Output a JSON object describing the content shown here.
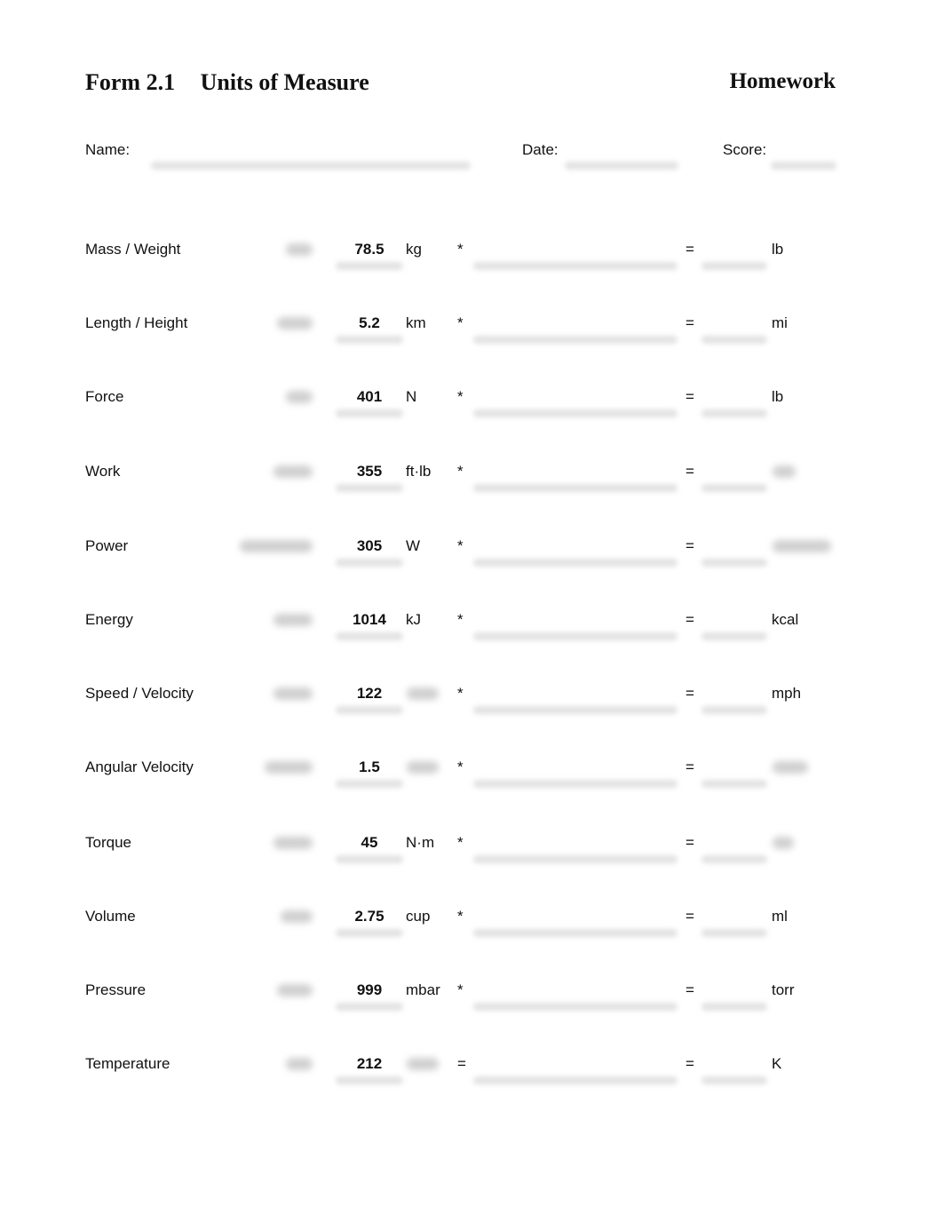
{
  "header": {
    "form_number": "Form 2.1",
    "title": "Units of Measure",
    "type": "Homework"
  },
  "fields": {
    "name_label": "Name:",
    "date_label": "Date:",
    "score_label": "Score:"
  },
  "rows": [
    {
      "label": "Mass / Weight",
      "value": "78.5",
      "from_unit": "kg",
      "operator": "*",
      "equals": "=",
      "to_unit": "lb"
    },
    {
      "label": "Length / Height",
      "value": "5.2",
      "from_unit": "km",
      "operator": "*",
      "equals": "=",
      "to_unit": "mi"
    },
    {
      "label": "Force",
      "value": "401",
      "from_unit": "N",
      "operator": "*",
      "equals": "=",
      "to_unit": "lb"
    },
    {
      "label": "Work",
      "value": "355",
      "from_unit": "ft·lb",
      "operator": "*",
      "equals": "=",
      "to_unit": ""
    },
    {
      "label": "Power",
      "value": "305",
      "from_unit": "W",
      "operator": "*",
      "equals": "=",
      "to_unit": ""
    },
    {
      "label": "Energy",
      "value": "1014",
      "from_unit": "kJ",
      "operator": "*",
      "equals": "=",
      "to_unit": "kcal"
    },
    {
      "label": "Speed / Velocity",
      "value": "122",
      "from_unit": "",
      "operator": "*",
      "equals": "=",
      "to_unit": "mph"
    },
    {
      "label": "Angular Velocity",
      "value": "1.5",
      "from_unit": "",
      "operator": "*",
      "equals": "=",
      "to_unit": ""
    },
    {
      "label": "Torque",
      "value": "45",
      "from_unit": "N·m",
      "operator": "*",
      "equals": "=",
      "to_unit": ""
    },
    {
      "label": "Volume",
      "value": "2.75",
      "from_unit": "cup",
      "operator": "*",
      "equals": "=",
      "to_unit": "ml"
    },
    {
      "label": "Pressure",
      "value": "999",
      "from_unit": "mbar",
      "operator": "*",
      "equals": "=",
      "to_unit": "torr"
    },
    {
      "label": "Temperature",
      "value": "212",
      "from_unit": "",
      "operator": "=",
      "equals": "=",
      "to_unit": "K"
    }
  ]
}
